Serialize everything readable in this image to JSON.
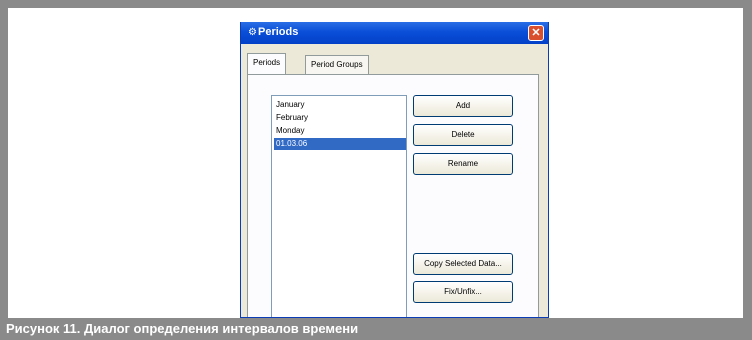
{
  "caption": "Рисунок 11. Диалог определения интервалов времени",
  "dialog": {
    "title": "Periods",
    "icons": {
      "app": "periods-app-icon",
      "close": "close-icon"
    },
    "tabs": [
      {
        "label": "Periods",
        "active": true
      },
      {
        "label": "Period Groups",
        "active": false
      }
    ],
    "list": {
      "items": [
        "January",
        "February",
        "Monday",
        "01.03.06"
      ],
      "selected_index": 3
    },
    "buttons": {
      "add": "Add",
      "delete": "Delete",
      "rename": "Rename",
      "copy_selected": "Copy Selected Data...",
      "fix_unfix": "Fix/Unfix..."
    }
  },
  "colors": {
    "frame": "#8a8a8a",
    "titlebar": "#0a4ed8",
    "selection": "#316ac5",
    "dialog_bg": "#ece9d8"
  }
}
